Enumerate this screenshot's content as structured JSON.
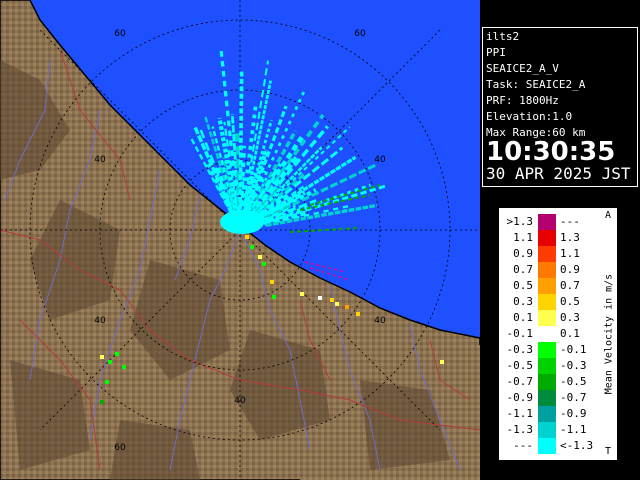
{
  "info": {
    "station": "ilts2",
    "mode": "PPI",
    "product": "SEAICE2_A_V",
    "task": "Task: SEAICE2_A",
    "prf": "PRF: 1800Hz",
    "elevation": "Elevation:1.0",
    "max_range": "Max Range:60 km",
    "time": "10:30:35",
    "date": "30 APR 2025 JST"
  },
  "legend": {
    "title": "Mean Velocity in m/s",
    "corner_top": "A",
    "corner_bottom": "T",
    "rows": [
      {
        "left": ">1.3",
        "right": "---",
        "color": "#b4006e"
      },
      {
        "left": "1.1",
        "right": "1.3",
        "color": "#e60000"
      },
      {
        "left": "0.9",
        "right": "1.1",
        "color": "#ff3c00"
      },
      {
        "left": "0.7",
        "right": "0.9",
        "color": "#ff7800"
      },
      {
        "left": "0.5",
        "right": "0.7",
        "color": "#ffa000"
      },
      {
        "left": "0.3",
        "right": "0.5",
        "color": "#ffd200"
      },
      {
        "left": "0.1",
        "right": "0.3",
        "color": "#ffff50"
      },
      {
        "left": "-0.1",
        "right": "0.1",
        "color": "#ffffff"
      },
      {
        "left": "-0.3",
        "right": "-0.1",
        "color": "#00ff00"
      },
      {
        "left": "-0.5",
        "right": "-0.3",
        "color": "#00d200"
      },
      {
        "left": "-0.7",
        "right": "-0.5",
        "color": "#00aa00"
      },
      {
        "left": "-0.9",
        "right": "-0.7",
        "color": "#008c3c"
      },
      {
        "left": "-1.1",
        "right": "-0.9",
        "color": "#00a0a0"
      },
      {
        "left": "-1.3",
        "right": "-1.1",
        "color": "#00d2d2"
      },
      {
        "left": "---",
        "right": "<-1.3",
        "color": "#00ffff"
      }
    ]
  },
  "map": {
    "range_labels": [
      "60",
      "60",
      "40",
      "40",
      "40",
      "40",
      "40",
      "60"
    ],
    "colors": {
      "sea": "#1e50ff",
      "land": "#8c7250",
      "land_dark": "#5a4630",
      "coast": "#000000",
      "rings": "#000000",
      "rivers": "#6e6ec8",
      "boundaries": "#b43c3c",
      "echo": "#00ffff"
    }
  }
}
